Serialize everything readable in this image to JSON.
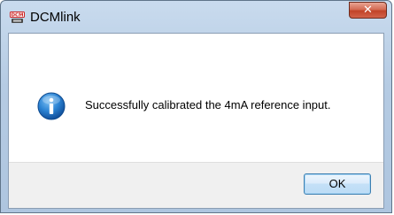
{
  "window": {
    "title": "DCMlink",
    "app_icon": "dcm-app-icon",
    "close_icon": "close-icon"
  },
  "dialog": {
    "icon": "info-icon",
    "message": "Successfully calibrated the 4mA reference input.",
    "ok_label": "OK"
  },
  "colors": {
    "title_bar": "#b9cfe6",
    "close_button": "#c94a30",
    "info_icon": "#1d6fc0",
    "ok_border": "#3c7fb1"
  }
}
